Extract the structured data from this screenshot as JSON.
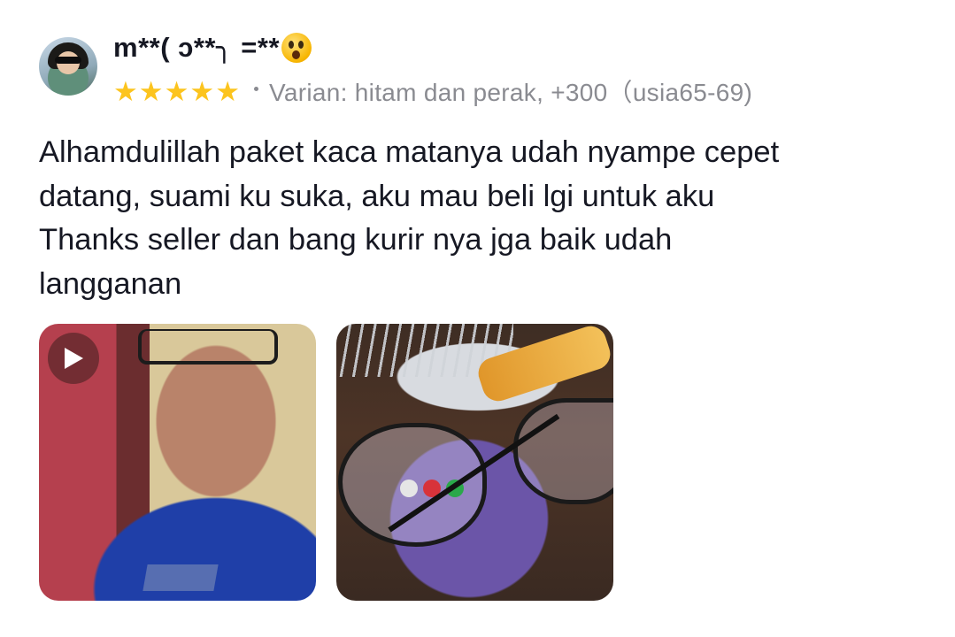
{
  "review": {
    "username": "m**( ͻ**╮ =**",
    "emoji": "astonished-face-emoji",
    "rating": 5,
    "rating_max": 5,
    "star_color": "#fcc41e",
    "variant": "Varian: hitam dan perak, +300（usia65-69)",
    "text": "Alhamdulillah paket kaca matanya udah nyampe cepet\ndatang,  suami ku suka, aku mau beli lgi untuk aku\nThanks seller dan bang kurir nya jga baik udah\nlangganan",
    "media": [
      {
        "type": "video",
        "icon": "play-icon"
      },
      {
        "type": "photo"
      }
    ]
  },
  "colors": {
    "text_primary": "#161823",
    "text_secondary": "#8a8b91"
  }
}
